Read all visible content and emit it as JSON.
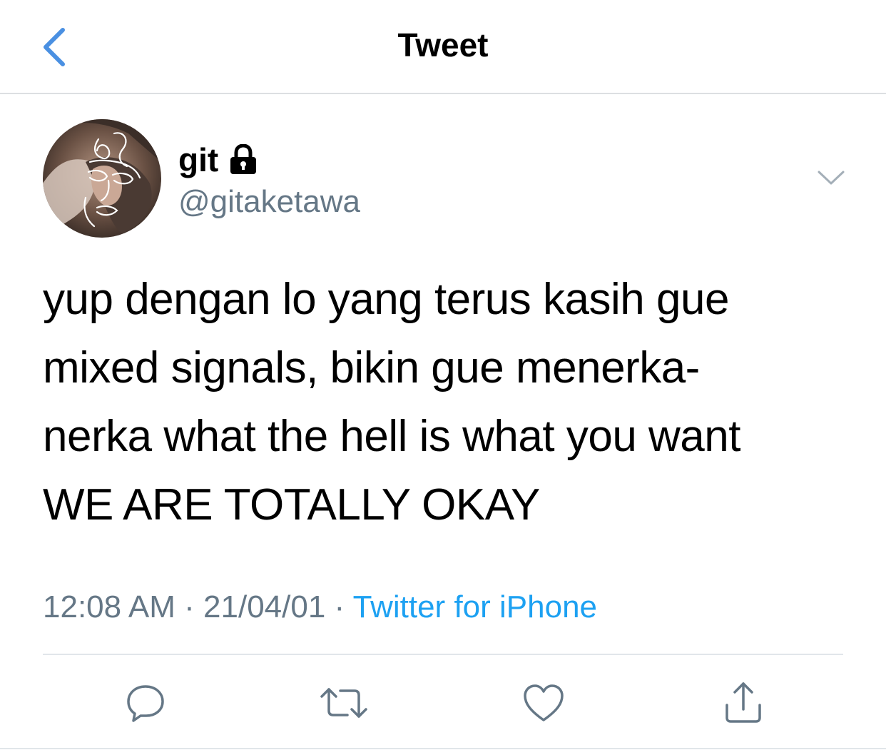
{
  "nav": {
    "title": "Tweet",
    "back_icon": "chevron-left-icon"
  },
  "author": {
    "display_name": "git",
    "protected_icon": "lock-icon",
    "handle": "@gitaketawa",
    "avatar": "profile-photo"
  },
  "tweet": {
    "lines": [
      "yup dengan lo yang terus kasih gue",
      "mixed signals, bikin gue menerka-",
      "nerka what the hell is what you want",
      "WE ARE TOTALLY OKAY"
    ],
    "time": "12:08 AM",
    "separator": "·",
    "date": "21/04/01",
    "source": "Twitter for iPhone"
  },
  "actions": [
    {
      "name": "reply",
      "icon": "reply-icon"
    },
    {
      "name": "retweet",
      "icon": "retweet-icon"
    },
    {
      "name": "like",
      "icon": "heart-icon"
    },
    {
      "name": "share",
      "icon": "share-icon"
    }
  ],
  "colors": {
    "accent": "#1da1f2",
    "secondary_text": "#657786",
    "back_chevron": "#4a90e2",
    "divider": "#e1e6ea"
  }
}
